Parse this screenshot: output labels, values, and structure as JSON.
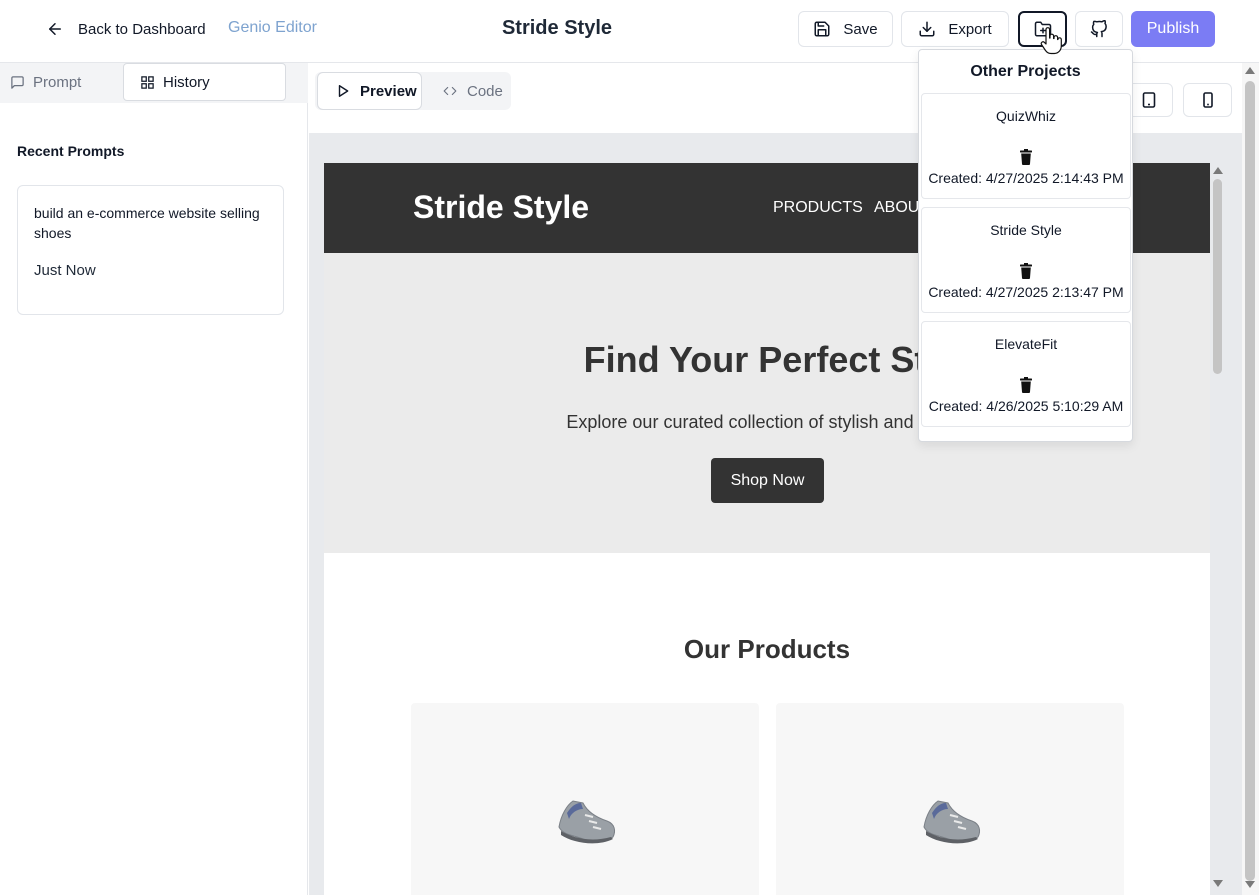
{
  "header": {
    "back_label": "Back to Dashboard",
    "brand": "Genio Editor",
    "project_title": "Stride Style",
    "save_label": "Save",
    "export_label": "Export",
    "publish_label": "Publish",
    "publish_color": "#7b7cf4"
  },
  "left_panel": {
    "tabs": [
      {
        "label": "Prompt",
        "icon": "message-icon",
        "active": false
      },
      {
        "label": "History",
        "icon": "grid-icon",
        "active": true
      }
    ],
    "recent_heading": "Recent Prompts",
    "prompts": [
      {
        "text": "build an e-commerce website selling shoes",
        "time": "Just Now"
      }
    ]
  },
  "preview": {
    "tabs": [
      {
        "label": "Preview",
        "icon": "play-icon",
        "active": true
      },
      {
        "label": "Code",
        "icon": "code-icon",
        "active": false
      }
    ],
    "devices": [
      "tablet-icon",
      "mobile-icon"
    ]
  },
  "site": {
    "logo": "Stride Style",
    "nav": [
      "PRODUCTS",
      "ABOUT"
    ],
    "hero_heading": "Find Your Perfect Stri",
    "hero_text": "Explore our curated collection of stylish and comfo",
    "hero_button": "Shop Now",
    "products_heading": "Our Products",
    "product_icon": "shoe-icon",
    "nav_color": "#333333",
    "hero_bg": "#ebebeb"
  },
  "projects_dropdown": {
    "title": "Other Projects",
    "items": [
      {
        "name": "QuizWhiz",
        "created": "Created: 4/27/2025 2:14:43 PM"
      },
      {
        "name": "Stride Style",
        "created": "Created: 4/27/2025 2:13:47 PM"
      },
      {
        "name": "ElevateFit",
        "created": "Created: 4/26/2025 5:10:29 AM"
      }
    ]
  }
}
